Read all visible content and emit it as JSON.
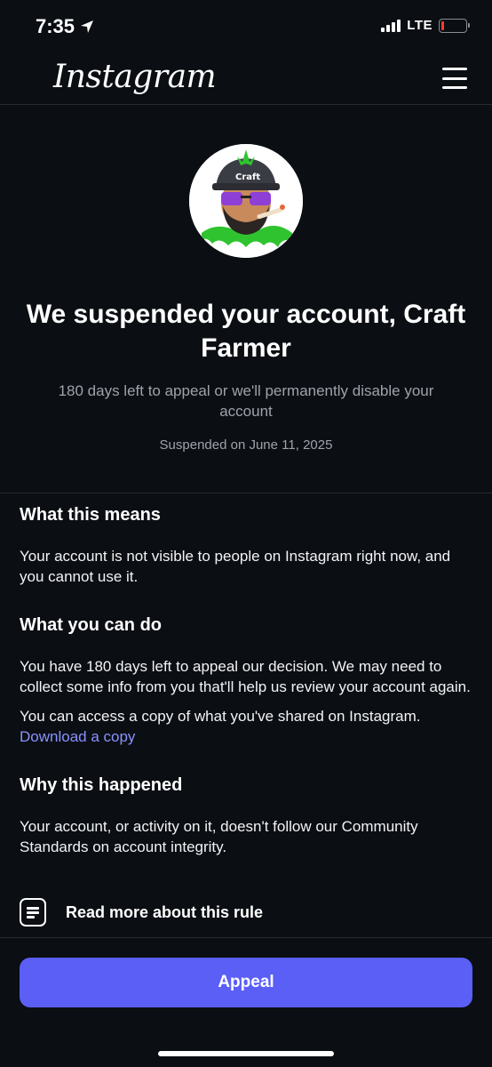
{
  "status_bar": {
    "time": "7:35",
    "network": "LTE",
    "battery_level": 0.1,
    "battery_color": "#ff3b30"
  },
  "header": {
    "logo": "Instagram",
    "menu_icon": "hamburger-menu-icon"
  },
  "profile": {
    "title": "We suspended your account, Craft Farmer",
    "subtitle": "180 days left to appeal or we'll permanently disable your account",
    "suspended_date": "Suspended on June 11, 2025"
  },
  "sections": {
    "means_heading": "What this means",
    "means_text": "Your account is not visible to people on Instagram right now, and you cannot use it.",
    "can_do_heading": "What you can do",
    "can_do_text": "You have 180 days left to appeal our decision. We may need to collect some info from you that'll help us review your account again.",
    "access_text": "You can access a copy of what you've shared on Instagram.",
    "download_link": "Download a copy",
    "why_heading": "Why this happened",
    "why_text": "Your account, or activity on it, doesn't follow our Community Standards on account integrity."
  },
  "rule": {
    "icon": "document-lines-icon",
    "label": "Read more about this rule"
  },
  "actions": {
    "appeal_label": "Appeal",
    "appeal_color": "#5b5ff6",
    "link_color": "#8a92ff"
  }
}
